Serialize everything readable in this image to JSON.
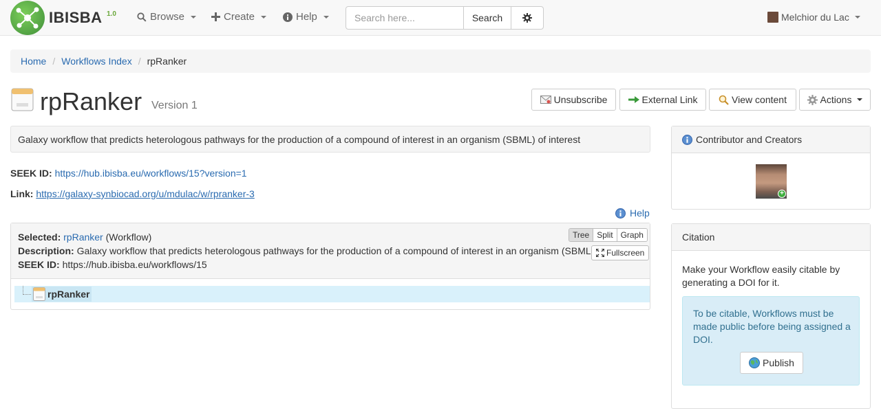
{
  "navbar": {
    "logo_text": "IBISBA",
    "logo_version": "1.0",
    "browse_label": "Browse",
    "create_label": "Create",
    "help_label": "Help",
    "search_placeholder": "Search here...",
    "search_button": "Search",
    "user_name": "Melchior du Lac"
  },
  "breadcrumb": [
    "Home",
    "Workflows Index",
    "rpRanker"
  ],
  "title": {
    "name": "rpRanker",
    "version": "Version 1"
  },
  "actions": {
    "unsubscribe": "Unsubscribe",
    "external_link": "External Link",
    "view_content": "View content",
    "actions": "Actions"
  },
  "description": "Galaxy workflow that predicts heterologous pathways for the production of a compound of interest in an organism (SBML) of interest",
  "seek_id": {
    "label": "SEEK ID:",
    "value": "https://hub.ibisba.eu/workflows/15?version=1"
  },
  "link": {
    "label": "Link:",
    "value": "https://galaxy-synbiocad.org/u/mdulac/w/rpranker-3"
  },
  "help_link": "Help",
  "tree": {
    "selected_label": "Selected:",
    "selected_name": "rpRanker",
    "selected_type": "(Workflow)",
    "description_label": "Description:",
    "description_value": "Galaxy workflow that predicts heterologous pathways for the production of a compound of interest in an organism (SBML) of interest",
    "seek_label": "SEEK ID:",
    "seek_value": "https://hub.ibisba.eu/workflows/15",
    "views": [
      "Tree",
      "Split",
      "Graph"
    ],
    "active_view": "Tree",
    "fullscreen": "Fullscreen",
    "node_label": "rpRanker"
  },
  "sidebar": {
    "contributors_title": "Contributor and Creators",
    "citation_title": "Citation",
    "citation_text": "Make your Workflow easily citable by generating a DOI for it.",
    "citation_alert": "To be citable, Workflows must be made public before being assigned a DOI.",
    "publish_button": "Publish"
  },
  "colors": {
    "link": "#2a6bb0",
    "brand_green": "#3f8e3a",
    "alert_bg": "#d9edf7",
    "selected_row": "#d9f1fb"
  }
}
